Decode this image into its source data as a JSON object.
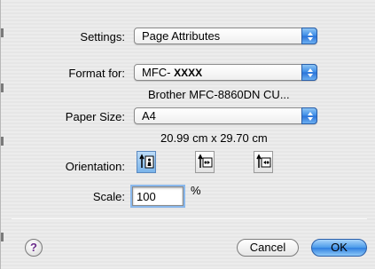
{
  "settings": {
    "label": "Settings:",
    "value": "Page Attributes"
  },
  "format_for": {
    "label": "Format for:",
    "value_prefix": "MFC-",
    "value_bold": "XXXX",
    "description": "Brother MFC-8860DN CU..."
  },
  "paper_size": {
    "label": "Paper Size:",
    "value": "A4",
    "dimensions": "20.99 cm x 29.70 cm"
  },
  "orientation": {
    "label": "Orientation:",
    "options": [
      {
        "name": "portrait",
        "selected": true
      },
      {
        "name": "landscape",
        "selected": false
      },
      {
        "name": "reverse-landscape",
        "selected": false
      }
    ]
  },
  "scale": {
    "label": "Scale:",
    "value": "100",
    "unit": "%"
  },
  "buttons": {
    "help": "?",
    "cancel": "Cancel",
    "ok": "OK"
  },
  "colors": {
    "accent": "#3a8ae6",
    "background": "#ececec"
  }
}
